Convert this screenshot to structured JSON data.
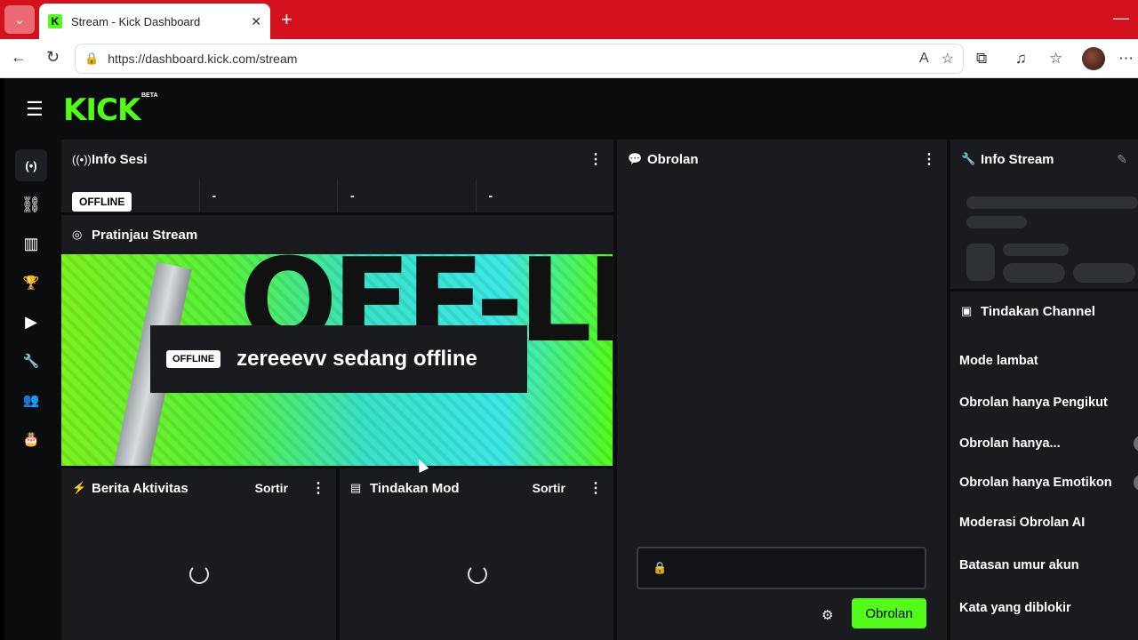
{
  "browser": {
    "tab_title": "Stream - Kick Dashboard",
    "tab_favicon": "K",
    "url": "https://dashboard.kick.com/stream"
  },
  "app": {
    "logo": "KICK",
    "logo_badge": "BETA",
    "accent_color": "#53fc18"
  },
  "sidebar": {
    "items": [
      {
        "icon": "broadcast-icon",
        "glyph": "(•)"
      },
      {
        "icon": "link-icon",
        "glyph": "⛓"
      },
      {
        "icon": "analytics-icon",
        "glyph": "▥"
      },
      {
        "icon": "trophy-icon",
        "glyph": "🏆"
      },
      {
        "icon": "video-icon",
        "glyph": "▶"
      },
      {
        "icon": "wrench-icon",
        "glyph": "🔧"
      },
      {
        "icon": "users-icon",
        "glyph": "👥"
      },
      {
        "icon": "cake-icon",
        "glyph": "🎂"
      }
    ]
  },
  "session_info": {
    "title": "Info Sesi",
    "status": "OFFLINE",
    "stats": [
      "-",
      "-",
      "-"
    ]
  },
  "preview": {
    "title": "Pratinjau Stream",
    "badge": "OFFLINE",
    "message": "zereeevv sedang offline",
    "background_text": "OFF-LINE"
  },
  "activity": {
    "title": "Berita Aktivitas",
    "sort_label": "Sortir"
  },
  "mod_actions": {
    "title": "Tindakan Mod",
    "sort_label": "Sortir"
  },
  "chat": {
    "title": "Obrolan",
    "input_placeholder": "",
    "send_label": "Obrolan"
  },
  "stream_info": {
    "title": "Info Stream"
  },
  "channel_actions": {
    "title": "Tindakan Channel",
    "items": [
      "Mode lambat",
      "Obrolan hanya Pengikut",
      "Obrolan hanya...",
      "Obrolan hanya Emotikon",
      "Moderasi Obrolan AI",
      "Batasan umur akun",
      "Kata yang diblokir"
    ]
  }
}
